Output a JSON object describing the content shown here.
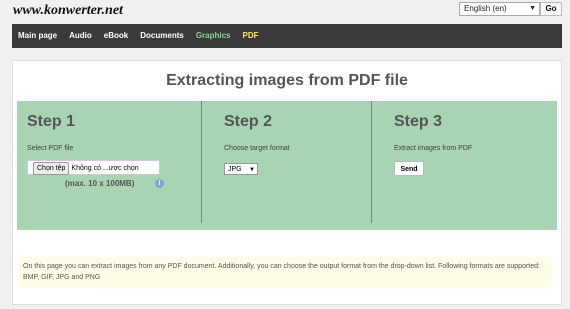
{
  "header": {
    "logo": "www.konwerter.net",
    "language": "English (en)",
    "go_label": "Go"
  },
  "nav": {
    "items": [
      {
        "label": "Main page"
      },
      {
        "label": "Audio"
      },
      {
        "label": "eBook"
      },
      {
        "label": "Documents"
      },
      {
        "label": "Graphics",
        "color": "#8fd38f"
      },
      {
        "label": "PDF",
        "color": "#ffe85a"
      }
    ]
  },
  "main": {
    "title": "Extracting images from PDF file",
    "steps": [
      {
        "heading": "Step 1",
        "subtitle": "Select PDF file",
        "file_button": "Chọn tệp",
        "file_status": "Không có ...ược chọn",
        "max_note": "(max. 10 x 100MB)",
        "info_icon": "i"
      },
      {
        "heading": "Step 2",
        "subtitle": "Choose target format",
        "format_value": "JPG"
      },
      {
        "heading": "Step 3",
        "subtitle": "Extract images from PDF",
        "send_label": "Send"
      }
    ],
    "description": "On this page you can extract images from any PDF document. Additionally, you can choose the output format from the drop-down list. Following formats are supported: BMP, GIF, JPG and PNG"
  },
  "colors": {
    "nav_bg": "#3a3a3a",
    "steps_bg": "#a8d4b4",
    "description_bg": "#fdfde6"
  }
}
